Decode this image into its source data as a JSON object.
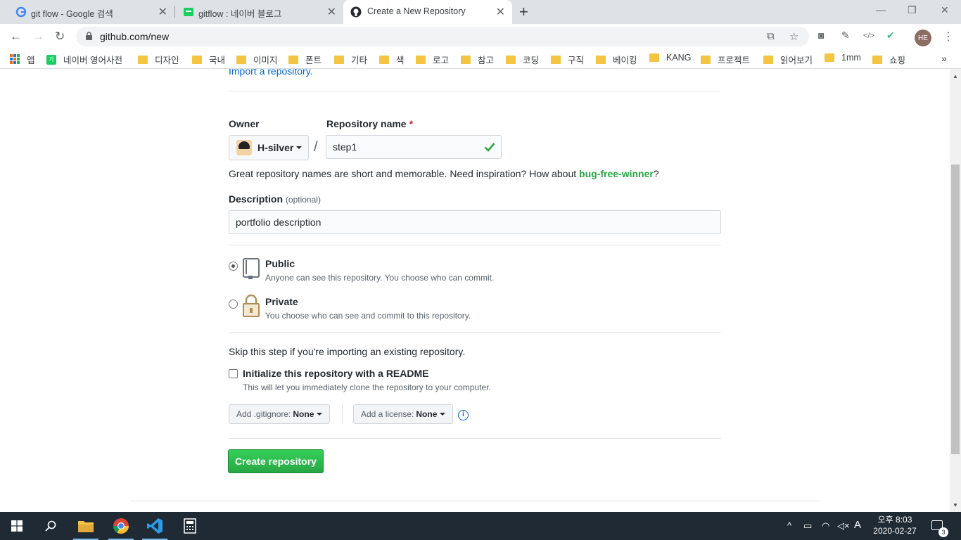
{
  "browser": {
    "tabs": [
      {
        "title": "git flow - Google 검색",
        "favicon": "google-icon"
      },
      {
        "title": "gitflow : 네이버 블로그",
        "favicon": "naver-blog-icon"
      },
      {
        "title": "Create a New Repository",
        "favicon": "github-icon"
      }
    ],
    "url": "github.com/new",
    "profile_initials": "HE",
    "bookmarks": [
      "앱",
      "네이버 영어사전",
      "디자인",
      "국내",
      "이미지",
      "폰트",
      "기타",
      "색",
      "로고",
      "참고",
      "코딩",
      "구직",
      "베이킹",
      "KANG",
      "프로젝트",
      "읽어보기",
      "1mm",
      "쇼핑"
    ]
  },
  "form": {
    "import_link": "Import a repository.",
    "owner_label": "Owner",
    "owner_value": "H-silver",
    "slash": "/",
    "repo_label": "Repository name",
    "required_mark": "*",
    "repo_value": "step1",
    "hint_prefix": "Great repository names are short and memorable. Need inspiration? How about",
    "hint_suggestion": "bug-free-winner",
    "hint_suffix": "?",
    "desc_label": "Description",
    "desc_optional": "(optional)",
    "desc_value": "portfolio description",
    "public_title": "Public",
    "public_desc": "Anyone can see this repository. You choose who can commit.",
    "private_title": "Private",
    "private_desc": "You choose who can see and commit to this repository.",
    "skip_note": "Skip this step if you're importing an existing repository.",
    "readme_title": "Initialize this repository with a README",
    "readme_desc": "This will let you immediately clone the repository to your computer.",
    "gitignore_label": "Add .gitignore:",
    "gitignore_value": "None",
    "license_label": "Add a license:",
    "license_value": "None",
    "info_glyph": "i",
    "create_button": "Create repository"
  },
  "taskbar": {
    "clock_time": "오후 8:03",
    "clock_date": "2020-02-27",
    "ime": "A",
    "notification_count": "3"
  },
  "colors": {
    "accent_green": "#28a745",
    "link_blue": "#0366d6",
    "taskbar": "#1f2a35"
  }
}
